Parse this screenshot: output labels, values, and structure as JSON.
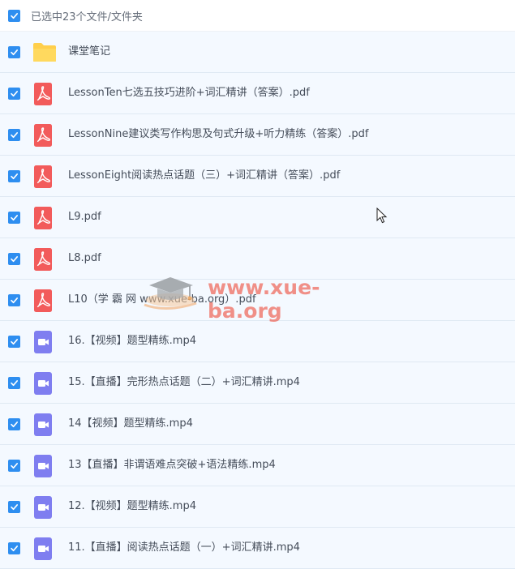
{
  "header": {
    "selection_text": "已选中23个文件/文件夹"
  },
  "files": [
    {
      "name": "课堂笔记",
      "type": "folder"
    },
    {
      "name": "LessonTen七选五技巧进阶+词汇精讲（答案）.pdf",
      "type": "pdf"
    },
    {
      "name": "LessonNine建议类写作构思及句式升级+听力精练（答案）.pdf",
      "type": "pdf"
    },
    {
      "name": "LessonEight阅读热点话题（三）+词汇精讲（答案）.pdf",
      "type": "pdf"
    },
    {
      "name": "L9.pdf",
      "type": "pdf"
    },
    {
      "name": "L8.pdf",
      "type": "pdf"
    },
    {
      "name": "L10（学 霸 网 www.xue-ba.org）.pdf",
      "type": "pdf"
    },
    {
      "name": "16.【视频】题型精练.mp4",
      "type": "video"
    },
    {
      "name": "15.【直播】完形热点话题（二）+词汇精讲.mp4",
      "type": "video"
    },
    {
      "name": "14【视频】题型精练.mp4",
      "type": "video"
    },
    {
      "name": "13【直播】非谓语难点突破+语法精练.mp4",
      "type": "video"
    },
    {
      "name": "12.【视频】题型精练.mp4",
      "type": "video"
    },
    {
      "name": "11.【直播】阅读热点话题（一）+词汇精讲.mp4",
      "type": "video"
    }
  ],
  "watermark": {
    "text": "www.xue-ba.org"
  },
  "colors": {
    "checkbox": "#2e8ef0",
    "row_bg": "#f4f9ff",
    "folder": "#ffcf4b",
    "pdf": "#f25b5b",
    "video": "#7f7ef0"
  }
}
